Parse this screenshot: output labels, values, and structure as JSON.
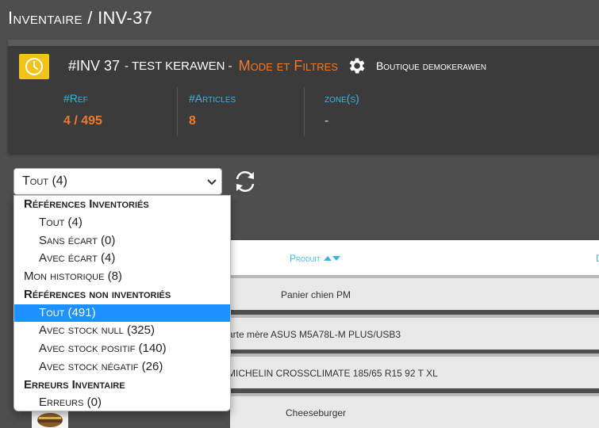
{
  "page": {
    "title": "Inventaire / INV-37"
  },
  "header": {
    "inv_number": "#INV 37",
    "inv_name": "- TEST KERAWEN -",
    "mode_link": "Mode et Filtres",
    "shop_name": "Boutique demokerawen",
    "stats": {
      "ref_label": "#Ref",
      "ref_value": "4 / 495",
      "articles_label": "#Articles",
      "articles_value": "8",
      "zone_label": "zone(s)",
      "zone_value": "-"
    },
    "icons": {
      "clock": "clock-icon",
      "gear": "gear-icon"
    },
    "colors": {
      "accent": "#f07a28",
      "label": "#3fb3df",
      "clock_bg": "#f0c419"
    }
  },
  "filter": {
    "selected": "Tout (4)",
    "options": [
      {
        "kind": "group",
        "label": "Références Inventoriés"
      },
      {
        "kind": "option",
        "label": "Tout (4)"
      },
      {
        "kind": "option",
        "label": "Sans écart (0)"
      },
      {
        "kind": "option",
        "label": "Avec écart (4)"
      },
      {
        "kind": "flat",
        "label": "Mon historique (8)"
      },
      {
        "kind": "group",
        "label": "Références non inventoriés"
      },
      {
        "kind": "option",
        "label": "Tout (491)",
        "highlighted": true
      },
      {
        "kind": "option",
        "label": "Avec stock null (325)"
      },
      {
        "kind": "option",
        "label": "Avec stock positif (140)"
      },
      {
        "kind": "option",
        "label": "Avec stock négatif (26)"
      },
      {
        "kind": "group",
        "label": "Erreurs Inventaire"
      },
      {
        "kind": "option",
        "label": "Erreurs (0)"
      }
    ]
  },
  "table": {
    "columns": {
      "produit": "Produit",
      "next": "D"
    },
    "rows": [
      {
        "product": "Panier chien PM"
      },
      {
        "product": "arte mère ASUS M5A78L-M PLUS/USB3"
      },
      {
        "product": "MICHELIN CROSSCLIMATE 185/65 R15 92 T XL"
      },
      {
        "product": "Cheeseburger"
      }
    ]
  }
}
